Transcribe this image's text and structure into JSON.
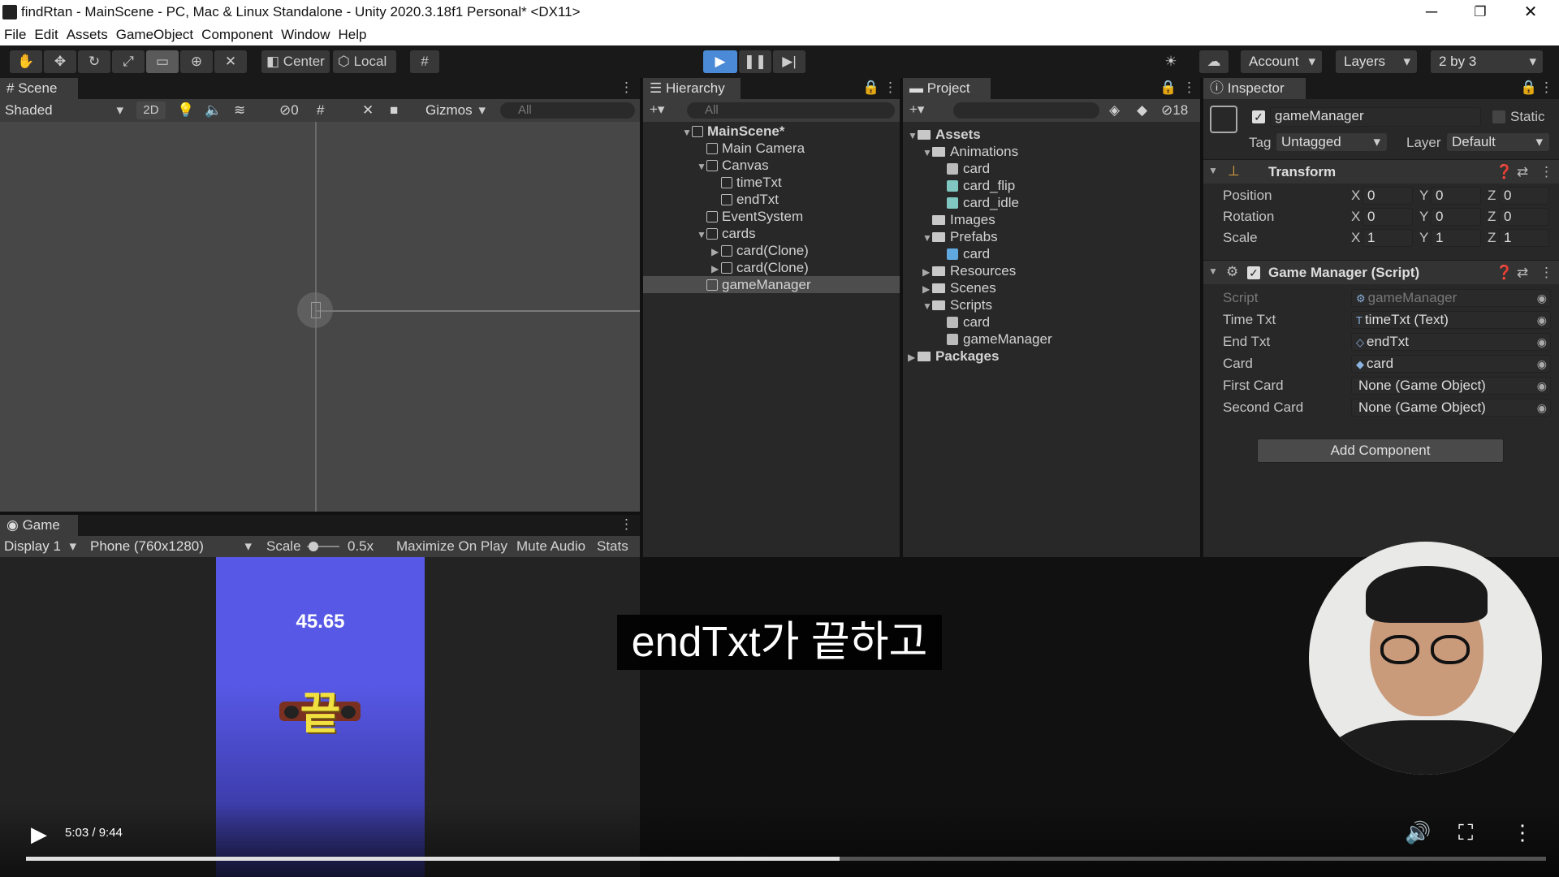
{
  "window": {
    "title": "findRtan - MainScene - PC, Mac & Linux Standalone - Unity 2020.3.18f1 Personal* <DX11>",
    "controls": [
      "─",
      "❐",
      "✕"
    ]
  },
  "menu": [
    "File",
    "Edit",
    "Assets",
    "GameObject",
    "Component",
    "Window",
    "Help"
  ],
  "toolbar": {
    "center_label": "Center",
    "local_label": "Local",
    "account_label": "Account",
    "layers_label": "Layers",
    "layout_label": "2 by 3"
  },
  "scene": {
    "tab": "Scene",
    "shading": "Shaded",
    "mode_2d": "2D",
    "hidden_count": "0",
    "gizmos": "Gizmos",
    "search_placeholder": "All"
  },
  "hierarchy": {
    "tab": "Hierarchy",
    "search_placeholder": "All",
    "items": [
      {
        "label": "MainScene*",
        "depth": 0,
        "expand": "▼",
        "kind": "scene"
      },
      {
        "label": "Main Camera",
        "depth": 1,
        "expand": "",
        "kind": "object"
      },
      {
        "label": "Canvas",
        "depth": 1,
        "expand": "▼",
        "kind": "object"
      },
      {
        "label": "timeTxt",
        "depth": 2,
        "expand": "",
        "kind": "object"
      },
      {
        "label": "endTxt",
        "depth": 2,
        "expand": "",
        "kind": "object"
      },
      {
        "label": "EventSystem",
        "depth": 1,
        "expand": "",
        "kind": "object"
      },
      {
        "label": "cards",
        "depth": 1,
        "expand": "▼",
        "kind": "object"
      },
      {
        "label": "card(Clone)",
        "depth": 2,
        "expand": "▶",
        "kind": "object"
      },
      {
        "label": "card(Clone)",
        "depth": 2,
        "expand": "▶",
        "kind": "object"
      },
      {
        "label": "gameManager",
        "depth": 1,
        "expand": "",
        "kind": "object",
        "selected": true
      }
    ]
  },
  "project": {
    "tab": "Project",
    "hidden_count": "18",
    "items": [
      {
        "label": "Assets",
        "depth": 0,
        "expand": "▼",
        "kind": "folder",
        "bold": true
      },
      {
        "label": "Animations",
        "depth": 1,
        "expand": "▼",
        "kind": "folder"
      },
      {
        "label": "card",
        "depth": 2,
        "expand": "",
        "kind": "animator"
      },
      {
        "label": "card_flip",
        "depth": 2,
        "expand": "",
        "kind": "anim"
      },
      {
        "label": "card_idle",
        "depth": 2,
        "expand": "",
        "kind": "anim"
      },
      {
        "label": "Images",
        "depth": 1,
        "expand": "",
        "kind": "folder"
      },
      {
        "label": "Prefabs",
        "depth": 1,
        "expand": "▼",
        "kind": "folder"
      },
      {
        "label": "card",
        "depth": 2,
        "expand": "",
        "kind": "prefab"
      },
      {
        "label": "Resources",
        "depth": 1,
        "expand": "▶",
        "kind": "folder"
      },
      {
        "label": "Scenes",
        "depth": 1,
        "expand": "▶",
        "kind": "folder"
      },
      {
        "label": "Scripts",
        "depth": 1,
        "expand": "▼",
        "kind": "folder"
      },
      {
        "label": "card",
        "depth": 2,
        "expand": "",
        "kind": "script"
      },
      {
        "label": "gameManager",
        "depth": 2,
        "expand": "",
        "kind": "gear"
      },
      {
        "label": "Packages",
        "depth": 0,
        "expand": "▶",
        "kind": "folder",
        "bold": true
      }
    ]
  },
  "inspector": {
    "tab": "Inspector",
    "object_name": "gameManager",
    "static_label": "Static",
    "tag_label": "Tag",
    "tag_value": "Untagged",
    "layer_label": "Layer",
    "layer_value": "Default",
    "transform": {
      "title": "Transform",
      "rows": [
        {
          "label": "Position",
          "x": "0",
          "y": "0",
          "z": "0"
        },
        {
          "label": "Rotation",
          "x": "0",
          "y": "0",
          "z": "0"
        },
        {
          "label": "Scale",
          "x": "1",
          "y": "1",
          "z": "1"
        }
      ]
    },
    "script_component": {
      "title": "Game Manager (Script)",
      "fields": [
        {
          "label": "Script",
          "value": "gameManager",
          "icon": "⚙",
          "disabled": true
        },
        {
          "label": "Time Txt",
          "value": "timeTxt (Text)",
          "icon": "T"
        },
        {
          "label": "End Txt",
          "value": "endTxt",
          "icon": "◇"
        },
        {
          "label": "Card",
          "value": "card",
          "icon": "◆"
        },
        {
          "label": "First Card",
          "value": "None (Game Object)",
          "icon": ""
        },
        {
          "label": "Second Card",
          "value": "None (Game Object)",
          "icon": ""
        }
      ]
    },
    "add_component": "Add Component"
  },
  "game": {
    "tab": "Game",
    "display": "Display 1",
    "resolution": "Phone (760x1280)",
    "scale_label": "Scale",
    "scale_value": "0.5x",
    "maximize": "Maximize On Play",
    "mute": "Mute Audio",
    "stats": "Stats",
    "time_text": "45.65",
    "end_text": "끝"
  },
  "video": {
    "caption": "endTxt가 끝하고",
    "time": "5:03 / 9:44",
    "progress": 0.535
  },
  "colors": {
    "play_active": "#4a8ad6",
    "phone_bg": "#5758e6",
    "end_text": "#f0e040"
  }
}
